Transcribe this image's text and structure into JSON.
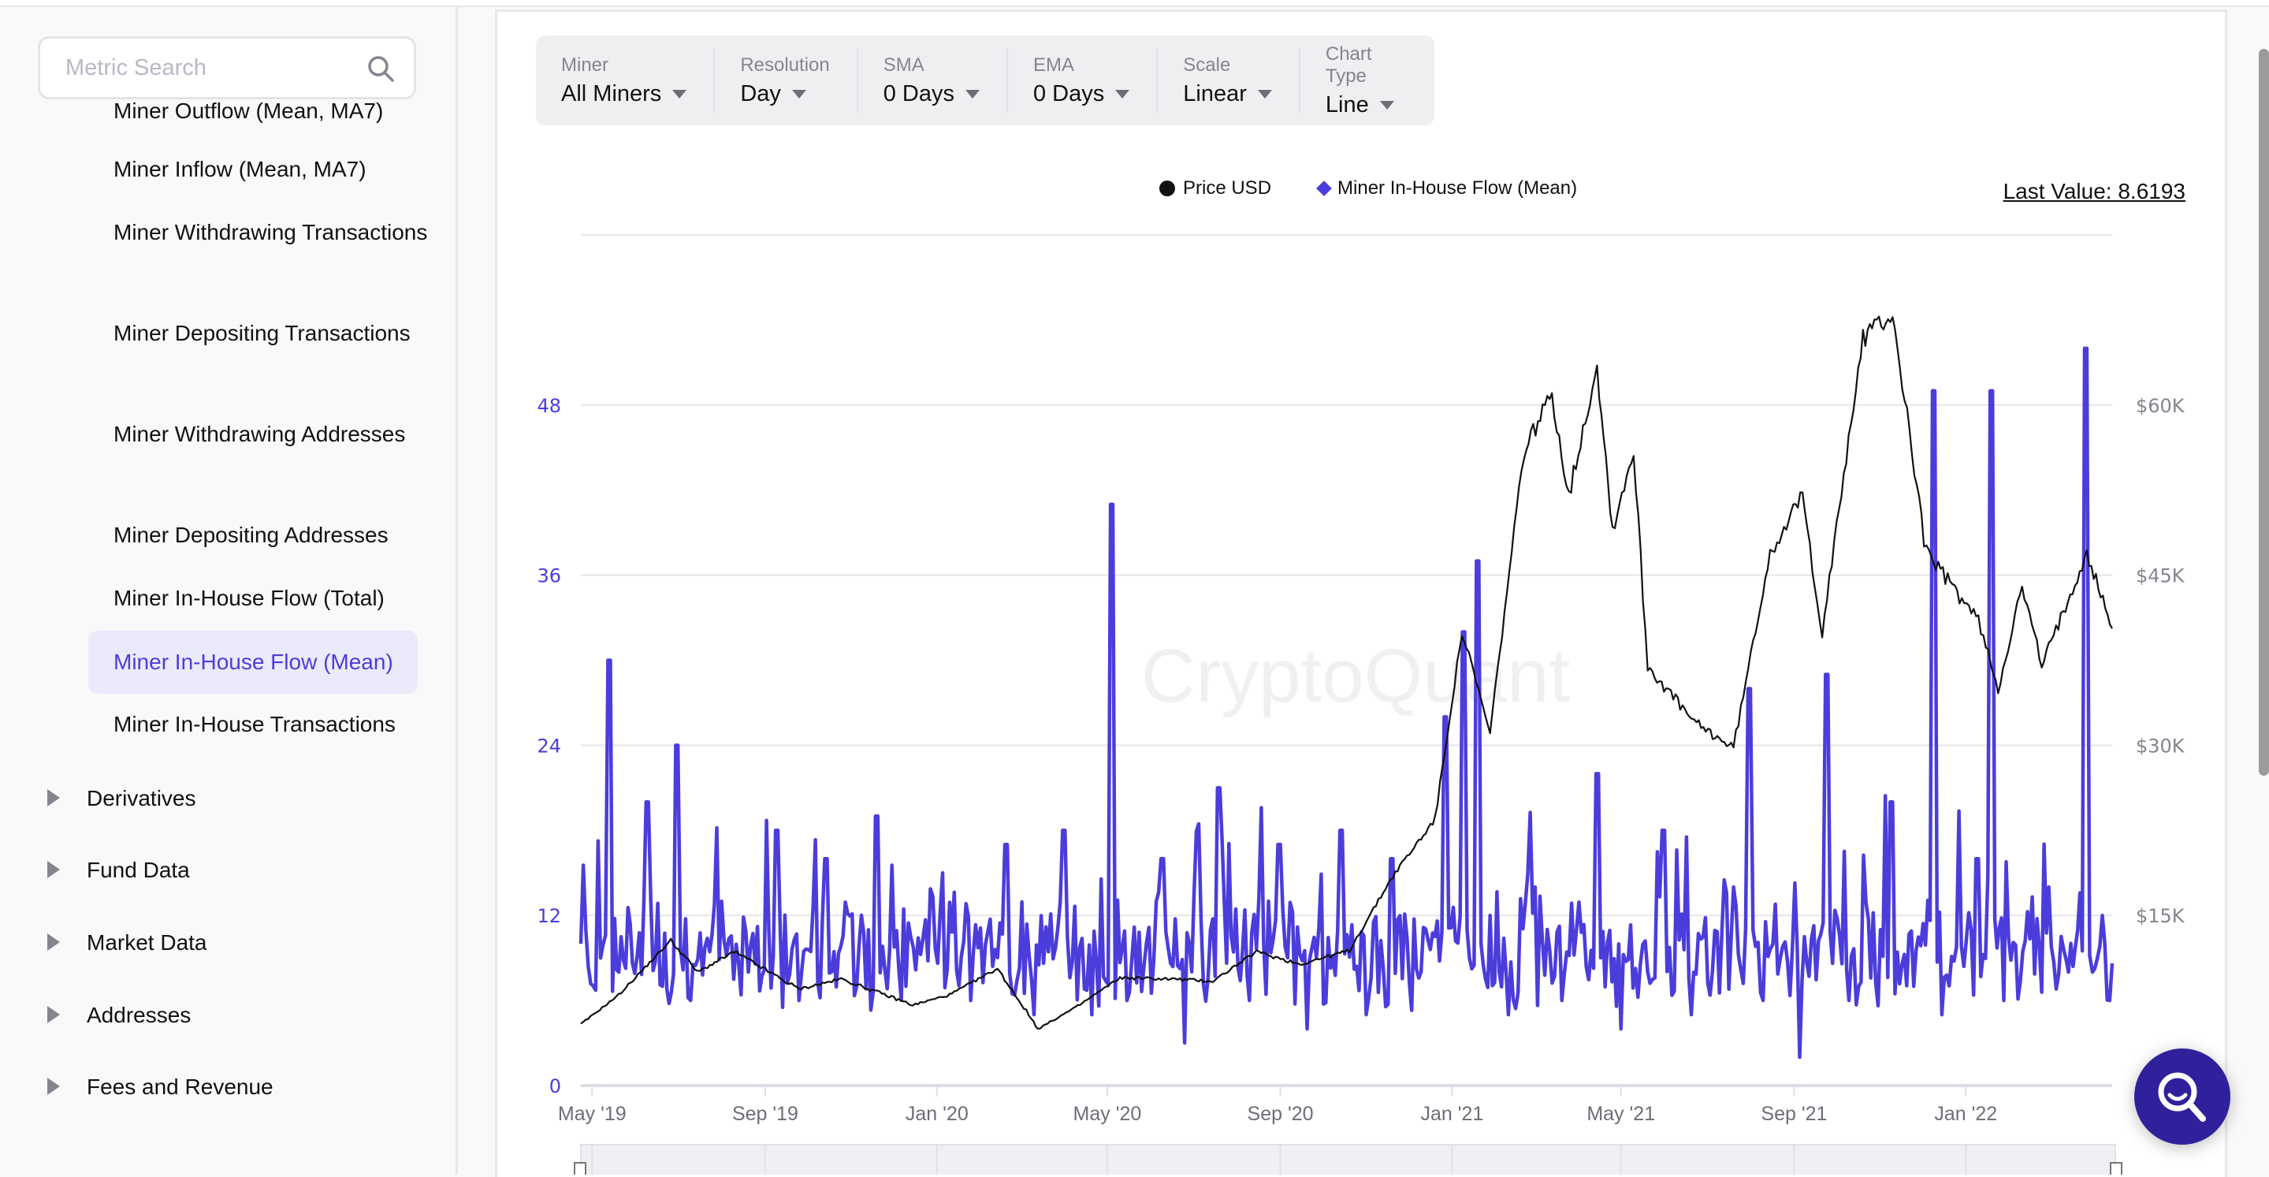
{
  "sidebar": {
    "search_placeholder": "Metric Search",
    "sub_items": [
      {
        "label": "Miner Outflow (Mean, MA7)",
        "active": false
      },
      {
        "label": "Miner Inflow (Mean, MA7)",
        "active": false
      },
      {
        "label": "Miner Withdrawing Transactions",
        "active": false
      },
      {
        "label": "Miner Depositing Transactions",
        "active": false
      },
      {
        "label": "Miner Withdrawing Addresses",
        "active": false
      },
      {
        "label": "Miner Depositing Addresses",
        "active": false
      },
      {
        "label": "Miner In-House Flow (Total)",
        "active": false
      },
      {
        "label": "Miner In-House Flow (Mean)",
        "active": true
      },
      {
        "label": "Miner In-House Transactions",
        "active": false
      }
    ],
    "categories": [
      "Derivatives",
      "Fund Data",
      "Market Data",
      "Addresses",
      "Fees and Revenue"
    ]
  },
  "controls": [
    {
      "label": "Miner",
      "value": "All Miners"
    },
    {
      "label": "Resolution",
      "value": "Day"
    },
    {
      "label": "SMA",
      "value": "0 Days"
    },
    {
      "label": "EMA",
      "value": "0 Days"
    },
    {
      "label": "Scale",
      "value": "Linear"
    },
    {
      "label": "Chart Type",
      "value": "Line"
    }
  ],
  "last_value": "Last Value: 8.6193",
  "watermark": "CryptoQuant",
  "colors": {
    "flow": "#4b3ddb",
    "price": "#111111",
    "accent": "#4b3ddb",
    "fab": "#2f219b"
  },
  "chart_data": {
    "type": "line",
    "title": "",
    "legend": [
      "Price USD",
      "Miner In-House Flow (Mean)"
    ],
    "legend_position": "top-center",
    "x_ticks": [
      "May '19",
      "Sep '19",
      "Jan '20",
      "May '20",
      "Sep '20",
      "Jan '21",
      "May '21",
      "Sep '21",
      "Jan '22"
    ],
    "x_range": [
      "2019-04-23",
      "2022-04-15"
    ],
    "y_left": {
      "label": "",
      "ticks": [
        "0",
        "12",
        "24",
        "36",
        "48"
      ],
      "range": [
        0,
        60
      ]
    },
    "y_right": {
      "label": "",
      "ticks": [
        "$15K",
        "$30K",
        "$45K",
        "$60K"
      ],
      "range": [
        0,
        75000
      ]
    },
    "grid": true,
    "series": [
      {
        "name": "Price USD",
        "axis": "right",
        "points": [
          [
            "2019-04-23",
            5400
          ],
          [
            "2019-05-20",
            8000
          ],
          [
            "2019-06-26",
            12800
          ],
          [
            "2019-07-15",
            10000
          ],
          [
            "2019-08-10",
            11800
          ],
          [
            "2019-09-25",
            8500
          ],
          [
            "2019-10-25",
            9400
          ],
          [
            "2019-12-15",
            7100
          ],
          [
            "2020-01-10",
            8000
          ],
          [
            "2020-02-13",
            10300
          ],
          [
            "2020-03-13",
            5000
          ],
          [
            "2020-04-10",
            7000
          ],
          [
            "2020-05-10",
            9500
          ],
          [
            "2020-06-15",
            9400
          ],
          [
            "2020-07-15",
            9200
          ],
          [
            "2020-08-15",
            11800
          ],
          [
            "2020-09-15",
            10700
          ],
          [
            "2020-10-20",
            11900
          ],
          [
            "2020-11-20",
            18500
          ],
          [
            "2020-12-20",
            23500
          ],
          [
            "2021-01-08",
            40000
          ],
          [
            "2021-01-28",
            31000
          ],
          [
            "2021-02-21",
            56000
          ],
          [
            "2021-03-13",
            61000
          ],
          [
            "2021-03-25",
            52000
          ],
          [
            "2021-04-14",
            63500
          ],
          [
            "2021-04-25",
            49000
          ],
          [
            "2021-05-10",
            56000
          ],
          [
            "2021-05-20",
            37000
          ],
          [
            "2021-06-22",
            32000
          ],
          [
            "2021-07-20",
            29800
          ],
          [
            "2021-08-15",
            47000
          ],
          [
            "2021-09-07",
            52000
          ],
          [
            "2021-09-21",
            40000
          ],
          [
            "2021-10-20",
            66000
          ],
          [
            "2021-11-10",
            68000
          ],
          [
            "2021-12-04",
            47000
          ],
          [
            "2022-01-10",
            41000
          ],
          [
            "2022-01-24",
            35000
          ],
          [
            "2022-02-10",
            44000
          ],
          [
            "2022-02-24",
            37000
          ],
          [
            "2022-03-28",
            47000
          ],
          [
            "2022-04-15",
            40300
          ]
        ]
      },
      {
        "name": "Miner In-House Flow (Mean)",
        "axis": "left",
        "points": [
          [
            "2019-04-23",
            10
          ],
          [
            "2019-05-07",
            9
          ],
          [
            "2019-05-14",
            30
          ],
          [
            "2019-05-20",
            8
          ],
          [
            "2019-06-10",
            20
          ],
          [
            "2019-06-20",
            7
          ],
          [
            "2019-07-01",
            24
          ],
          [
            "2019-07-10",
            6
          ],
          [
            "2019-08-01",
            13
          ],
          [
            "2019-08-20",
            8
          ],
          [
            "2019-09-10",
            18
          ],
          [
            "2019-09-25",
            6
          ],
          [
            "2019-10-15",
            16
          ],
          [
            "2019-11-05",
            7
          ],
          [
            "2019-11-20",
            19
          ],
          [
            "2019-12-10",
            7
          ],
          [
            "2020-01-05",
            15
          ],
          [
            "2020-01-25",
            6
          ],
          [
            "2020-02-20",
            17
          ],
          [
            "2020-03-10",
            5
          ],
          [
            "2020-04-01",
            18
          ],
          [
            "2020-04-20",
            5
          ],
          [
            "2020-05-05",
            41
          ],
          [
            "2020-05-15",
            6
          ],
          [
            "2020-06-10",
            16
          ],
          [
            "2020-06-25",
            3
          ],
          [
            "2020-07-20",
            21
          ],
          [
            "2020-08-10",
            6
          ],
          [
            "2020-09-01",
            17
          ],
          [
            "2020-09-20",
            4
          ],
          [
            "2020-10-15",
            18
          ],
          [
            "2020-11-01",
            5
          ],
          [
            "2020-11-20",
            16
          ],
          [
            "2020-12-10",
            8
          ],
          [
            "2020-12-28",
            26
          ],
          [
            "2021-01-10",
            32
          ],
          [
            "2021-01-20",
            37
          ],
          [
            "2021-01-28",
            12
          ],
          [
            "2021-02-10",
            5
          ],
          [
            "2021-03-01",
            14
          ],
          [
            "2021-03-20",
            6
          ],
          [
            "2021-04-15",
            22
          ],
          [
            "2021-05-01",
            4
          ],
          [
            "2021-06-01",
            18
          ],
          [
            "2021-06-20",
            5
          ],
          [
            "2021-07-20",
            14
          ],
          [
            "2021-08-01",
            28
          ],
          [
            "2021-08-10",
            6
          ],
          [
            "2021-09-05",
            2
          ],
          [
            "2021-09-25",
            29
          ],
          [
            "2021-10-10",
            6
          ],
          [
            "2021-11-10",
            20
          ],
          [
            "2021-11-25",
            7
          ],
          [
            "2021-12-10",
            49
          ],
          [
            "2021-12-15",
            5
          ],
          [
            "2022-01-10",
            16
          ],
          [
            "2022-01-20",
            49
          ],
          [
            "2022-01-28",
            6
          ],
          [
            "2022-03-01",
            14
          ],
          [
            "2022-03-15",
            8
          ],
          [
            "2022-03-28",
            52
          ],
          [
            "2022-04-01",
            8
          ],
          [
            "2022-04-08",
            12
          ],
          [
            "2022-04-15",
            8.6193
          ]
        ]
      }
    ]
  }
}
